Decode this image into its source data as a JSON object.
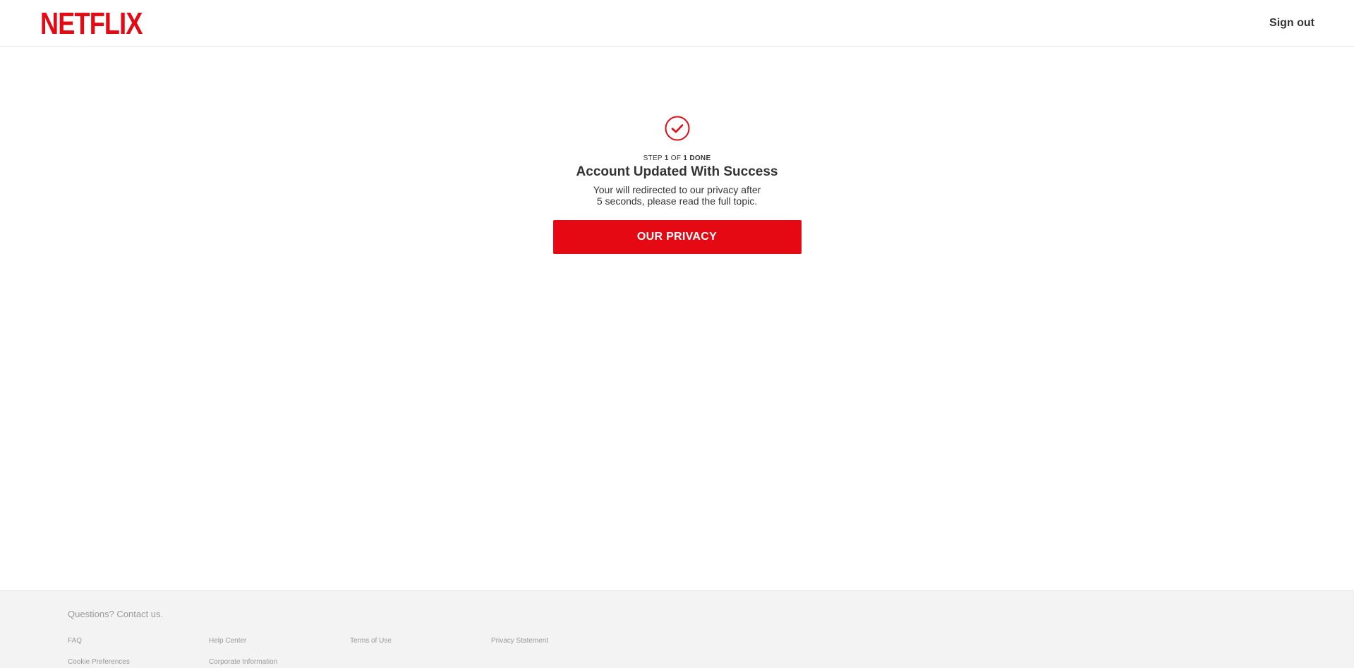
{
  "header": {
    "logo_text": "NETFLIX",
    "signout_label": "Sign out"
  },
  "main": {
    "step": {
      "prefix": "STEP",
      "current": "1",
      "of": "OF",
      "total": "1",
      "suffix": "DONE"
    },
    "title": "Account Updated With Success",
    "subtitle_line1": "Your will redirected to our privacy after",
    "subtitle_line2": "5 seconds, please read the full topic.",
    "button_label": "OUR PRIVACY"
  },
  "footer": {
    "contact": "Questions? Contact us.",
    "links": [
      "FAQ",
      "Help Center",
      "Terms of Use",
      "Privacy Statement",
      "Cookie Preferences",
      "Corporate Information"
    ]
  },
  "colors": {
    "brand_red": "#e50914",
    "text": "#333333",
    "footer_bg": "#f3f3f3",
    "footer_text": "#999999"
  },
  "icons": {
    "success": "check-circle-icon"
  }
}
